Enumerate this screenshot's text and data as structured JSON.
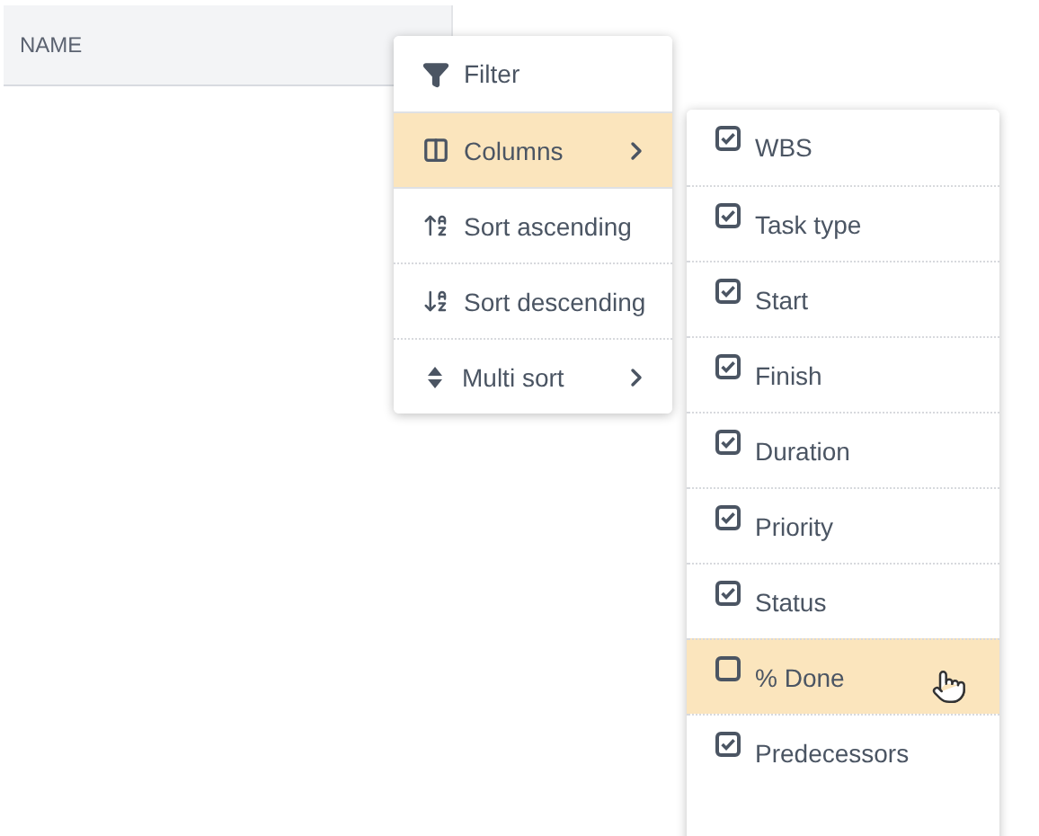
{
  "header": {
    "column_title": "NAME"
  },
  "menu": {
    "items": [
      {
        "kind": "filter",
        "label": "Filter",
        "highlighted": false,
        "has_submenu": false
      },
      {
        "kind": "columns",
        "label": "Columns",
        "highlighted": true,
        "has_submenu": true
      },
      {
        "kind": "sort_asc",
        "label": "Sort ascending",
        "highlighted": false,
        "has_submenu": false
      },
      {
        "kind": "sort_desc",
        "label": "Sort descending",
        "highlighted": false,
        "has_submenu": false
      },
      {
        "kind": "multi_sort",
        "label": "Multi sort",
        "highlighted": false,
        "has_submenu": true
      }
    ]
  },
  "columns_submenu": {
    "items": [
      {
        "label": "WBS",
        "checked": true,
        "highlighted": false
      },
      {
        "label": "Task type",
        "checked": true,
        "highlighted": false
      },
      {
        "label": "Start",
        "checked": true,
        "highlighted": false
      },
      {
        "label": "Finish",
        "checked": true,
        "highlighted": false
      },
      {
        "label": "Duration",
        "checked": true,
        "highlighted": false
      },
      {
        "label": "Priority",
        "checked": true,
        "highlighted": false
      },
      {
        "label": "Status",
        "checked": true,
        "highlighted": false
      },
      {
        "label": "% Done",
        "checked": false,
        "highlighted": true
      },
      {
        "label": "Predecessors",
        "checked": true,
        "highlighted": false
      }
    ]
  }
}
